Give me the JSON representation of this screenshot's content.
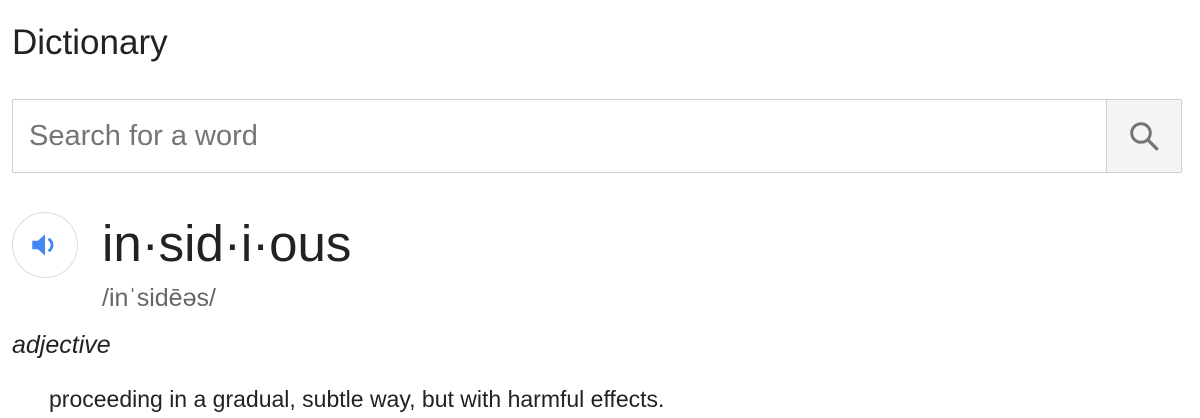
{
  "title": "Dictionary",
  "search": {
    "placeholder": "Search for a word",
    "value": "",
    "button_icon": "search-icon"
  },
  "entry": {
    "audio_icon": "speaker-icon",
    "headword": "in·sid·i·ous",
    "phonetic": "/inˈsidēəs/",
    "part_of_speech": "adjective",
    "definition": "proceeding in a gradual, subtle way, but with harmful effects."
  },
  "colors": {
    "accent": "#4285f4",
    "icon_gray": "#757575",
    "border": "#cfcfcf",
    "button_bg": "#f5f5f5"
  }
}
